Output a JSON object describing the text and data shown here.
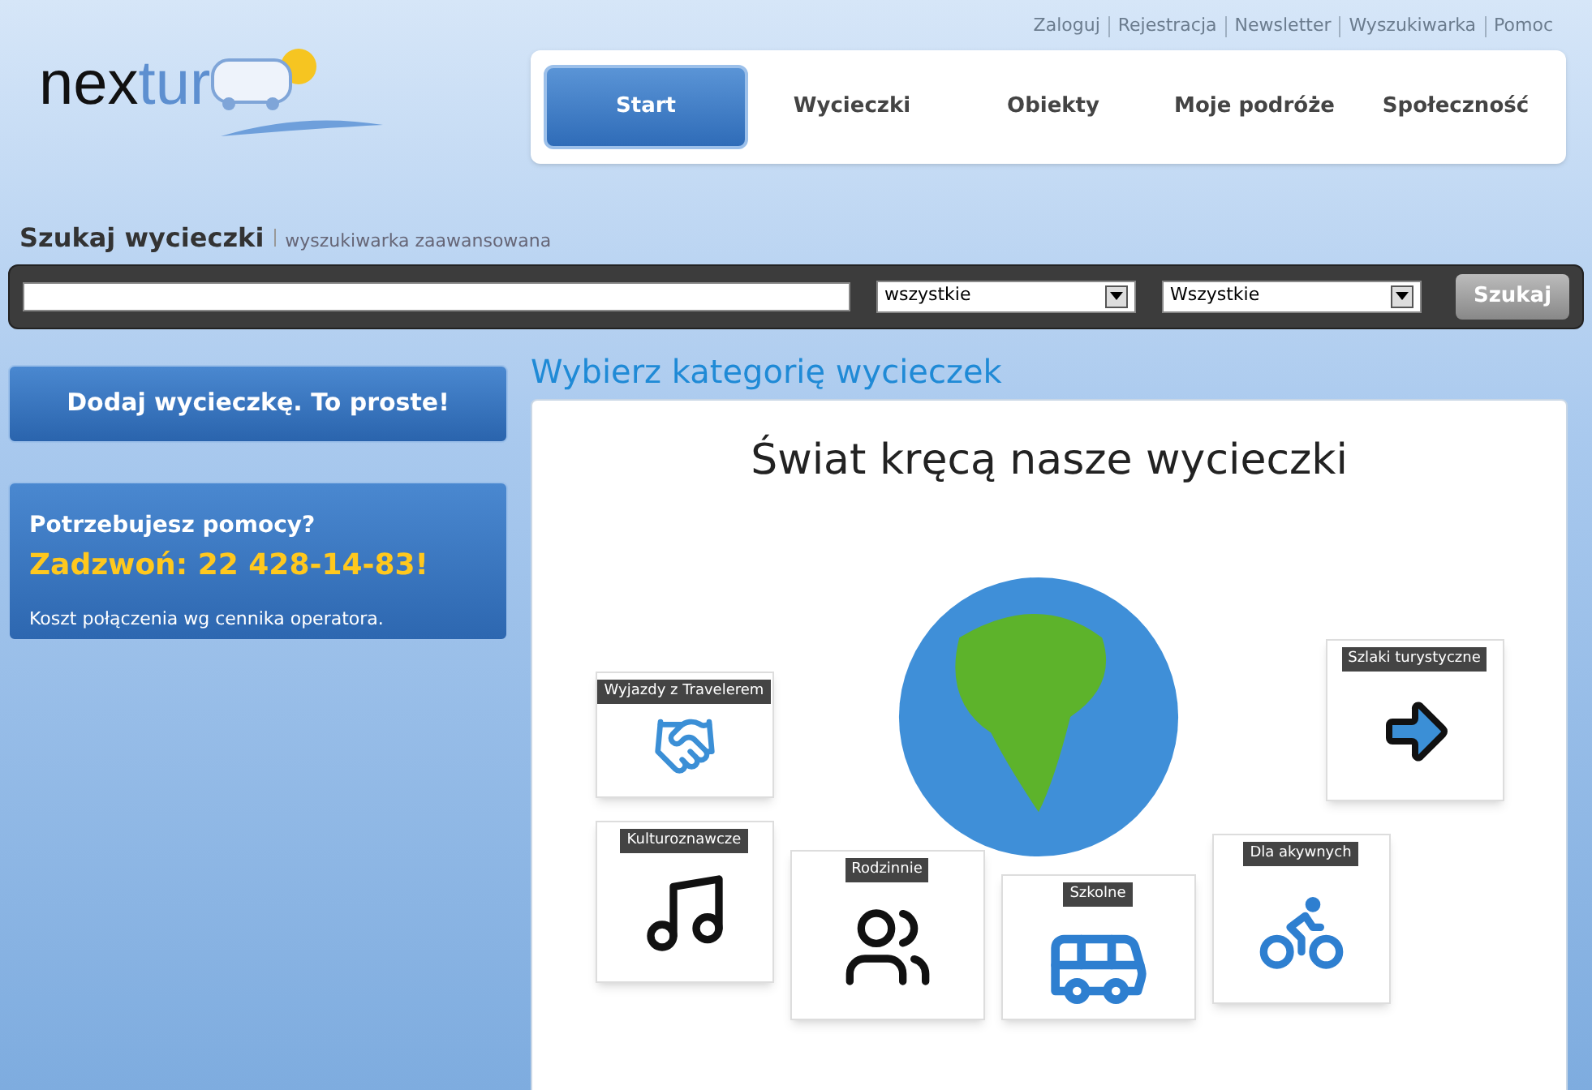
{
  "top_links": [
    "Zaloguj",
    "Rejestracja",
    "Newsletter",
    "Wyszukiwarka",
    "Pomoc"
  ],
  "logo": {
    "text_dark": "nex",
    "text_light": "tur"
  },
  "nav": [
    {
      "label": "Start",
      "selected": true
    },
    {
      "label": "Wycieczki",
      "selected": false
    },
    {
      "label": "Obiekty",
      "selected": false
    },
    {
      "label": "Moje podróże",
      "selected": false
    },
    {
      "label": "Społeczność",
      "selected": false
    }
  ],
  "search": {
    "title": "Szukaj wycieczki",
    "link": "wyszukiwarka zaawansowana",
    "select_1": "wszystkie",
    "select_2": "Wszystkie",
    "button": "Szukaj"
  },
  "add_trip": "Dodaj wycieczkę. To proste!",
  "help": {
    "question": "Potrzebujesz pomocy?",
    "phone": "Zadzwoń: 22 428-14-83!",
    "note": "Koszt połączenia wg cennika operatora."
  },
  "categories_heading": "Wybierz kategorię wycieczek",
  "banner": {
    "title": "Świat kręcą nasze wycieczki",
    "cards": [
      {
        "label": "Wyjazdy z Travelerem",
        "kind": "hands"
      },
      {
        "label": "Szlaki turystyczne",
        "kind": "arrow"
      },
      {
        "label": "Kulturoznawcze",
        "kind": "lyre"
      },
      {
        "label": "Rodzinnie",
        "kind": "family"
      },
      {
        "label": "Szkolne",
        "kind": "bus"
      },
      {
        "label": "Dla akywnych",
        "kind": "bike"
      }
    ]
  }
}
